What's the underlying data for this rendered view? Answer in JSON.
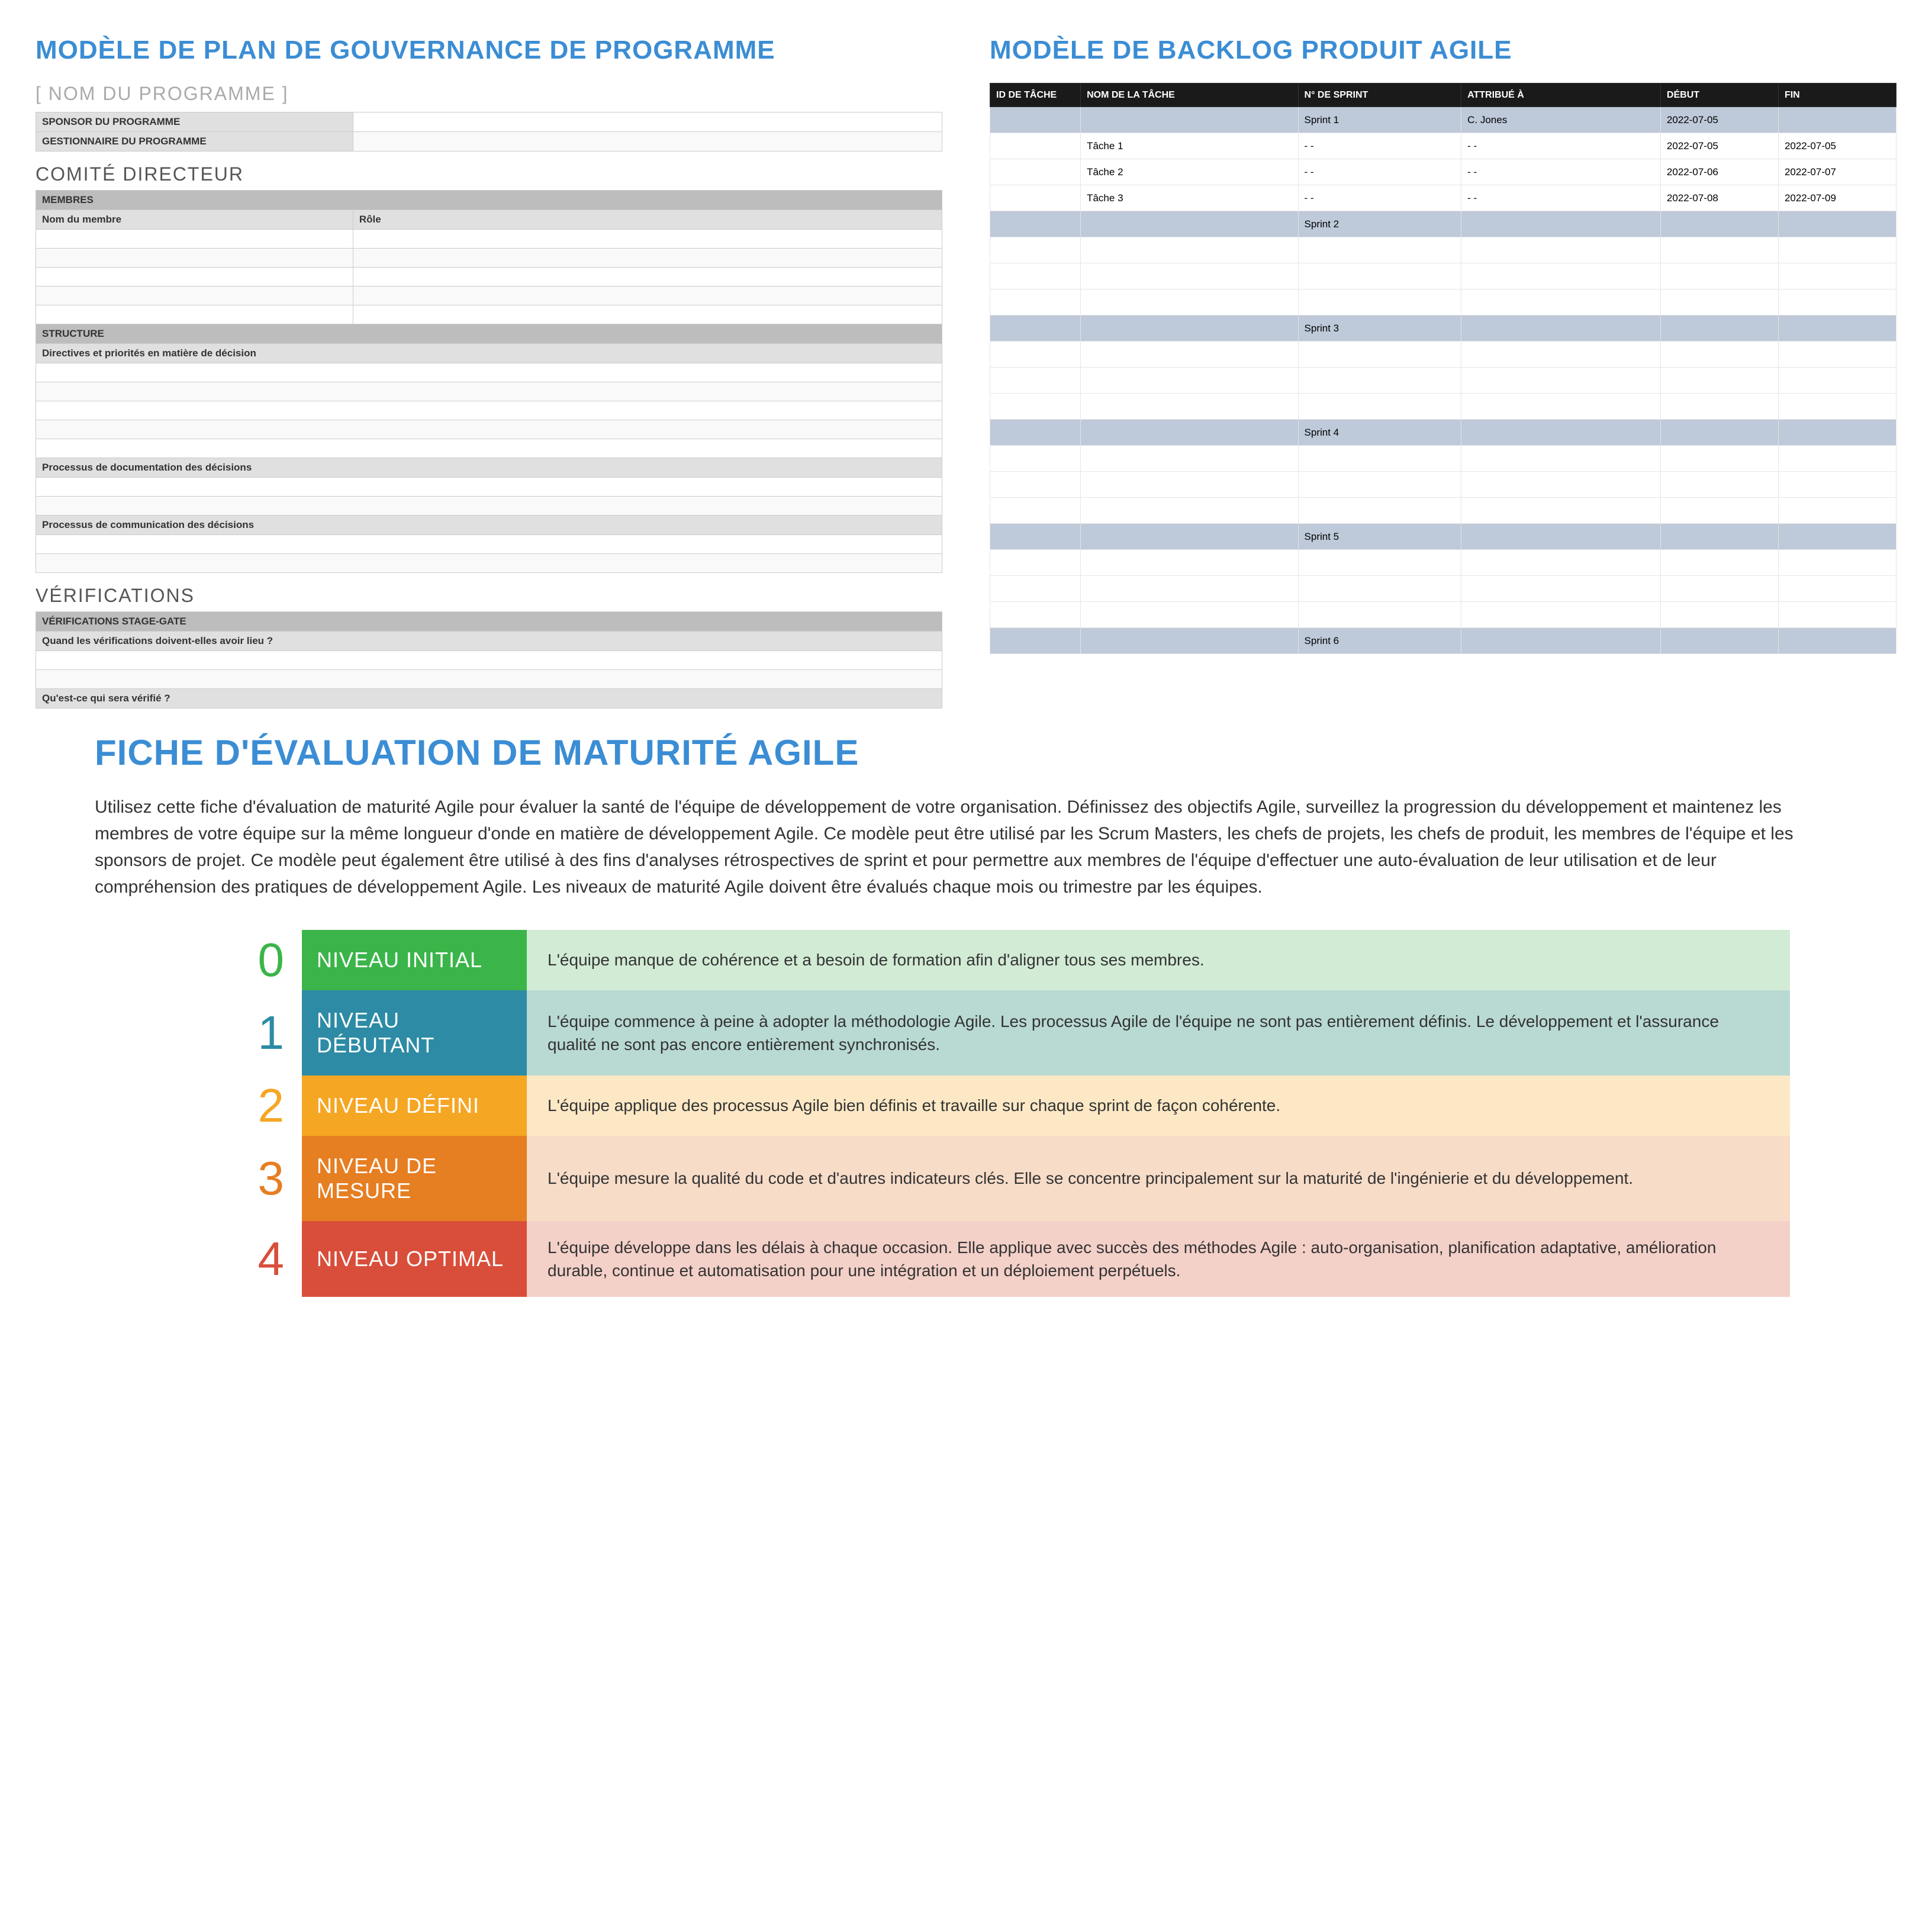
{
  "governance": {
    "title": "MODÈLE DE PLAN DE GOUVERNANCE DE PROGRAMME",
    "programName": "[ NOM DU PROGRAMME ]",
    "sponsorLabel": "SPONSOR DU PROGRAMME",
    "managerLabel": "GESTIONNAIRE DU PROGRAMME",
    "steering": {
      "title": "COMITÉ DIRECTEUR",
      "membersHeader": "MEMBRES",
      "memberNameCol": "Nom du membre",
      "roleCol": "Rôle",
      "structureHeader": "STRUCTURE",
      "directivesLabel": "Directives et priorités en matière de décision",
      "documentationLabel": "Processus de documentation des décisions",
      "communicationLabel": "Processus de communication des décisions"
    },
    "verifications": {
      "title": "VÉRIFICATIONS",
      "stageGateHeader": "VÉRIFICATIONS STAGE-GATE",
      "whenQuestion": "Quand les vérifications doivent-elles avoir lieu ?",
      "whatQuestion": "Qu'est-ce qui sera vérifié ?"
    }
  },
  "backlog": {
    "title": "MODÈLE DE BACKLOG PRODUIT AGILE",
    "headers": {
      "taskId": "ID DE TÂCHE",
      "taskName": "NOM DE LA TÂCHE",
      "sprintNo": "N° DE SPRINT",
      "assignedTo": "ATTRIBUÉ À",
      "start": "DÉBUT",
      "end": "FIN"
    },
    "rows": [
      {
        "type": "sprint",
        "sprint": "Sprint 1",
        "assigned": "C. Jones",
        "start": "2022-07-05"
      },
      {
        "type": "task",
        "name": "Tâche 1",
        "sprint": "- -",
        "assigned": "- -",
        "start": "2022-07-05",
        "end": "2022-07-05"
      },
      {
        "type": "task",
        "name": "Tâche 2",
        "sprint": "- -",
        "assigned": "- -",
        "start": "2022-07-06",
        "end": "2022-07-07"
      },
      {
        "type": "task",
        "name": "Tâche 3",
        "sprint": "- -",
        "assigned": "- -",
        "start": "2022-07-08",
        "end": "2022-07-09"
      },
      {
        "type": "sprint",
        "sprint": "Sprint 2"
      },
      {
        "type": "task"
      },
      {
        "type": "task"
      },
      {
        "type": "task"
      },
      {
        "type": "sprint",
        "sprint": "Sprint 3"
      },
      {
        "type": "task"
      },
      {
        "type": "task"
      },
      {
        "type": "task"
      },
      {
        "type": "sprint",
        "sprint": "Sprint 4"
      },
      {
        "type": "task"
      },
      {
        "type": "task"
      },
      {
        "type": "task"
      },
      {
        "type": "sprint",
        "sprint": "Sprint 5"
      },
      {
        "type": "task"
      },
      {
        "type": "task"
      },
      {
        "type": "task"
      },
      {
        "type": "sprint",
        "sprint": "Sprint 6"
      }
    ]
  },
  "maturity": {
    "title": "FICHE D'ÉVALUATION DE MATURITÉ AGILE",
    "intro": "Utilisez cette fiche d'évaluation de maturité Agile pour évaluer la santé de l'équipe de développement de votre organisation.  Définissez des objectifs Agile, surveillez la progression du développement et maintenez les membres de votre équipe sur la même longueur d'onde en matière de développement Agile. Ce modèle peut être utilisé par les Scrum Masters, les chefs de projets, les chefs de produit, les membres de l'équipe et les sponsors de projet. Ce modèle peut également être utilisé à des fins d'analyses rétrospectives de sprint et pour permettre aux membres de l'équipe d'effectuer une auto-évaluation de leur utilisation et de leur compréhension des pratiques de développement Agile. Les niveaux de maturité Agile doivent être évalués chaque mois ou trimestre par les équipes.",
    "levels": [
      {
        "num": "0",
        "label": "NIVEAU INITIAL",
        "desc": "L'équipe manque de cohérence et a besoin de formation afin d'aligner tous ses membres."
      },
      {
        "num": "1",
        "label": "NIVEAU DÉBUTANT",
        "desc": "L'équipe commence à peine à adopter la méthodologie Agile. Les processus Agile de l'équipe ne sont pas entièrement définis. Le développement et l'assurance qualité ne sont pas encore entièrement synchronisés."
      },
      {
        "num": "2",
        "label": "NIVEAU DÉFINI",
        "desc": "L'équipe applique des processus Agile bien définis et travaille sur chaque sprint de façon cohérente."
      },
      {
        "num": "3",
        "label": "NIVEAU DE MESURE",
        "desc": "L'équipe mesure la qualité du code et d'autres indicateurs clés. Elle se concentre principalement sur la maturité de l'ingénierie et du développement."
      },
      {
        "num": "4",
        "label": "NIVEAU OPTIMAL",
        "desc": "L'équipe développe dans les délais à chaque occasion. Elle applique avec succès des méthodes Agile : auto-organisation, planification adaptative, amélioration durable, continue et automatisation pour une intégration et un déploiement perpétuels."
      }
    ]
  }
}
